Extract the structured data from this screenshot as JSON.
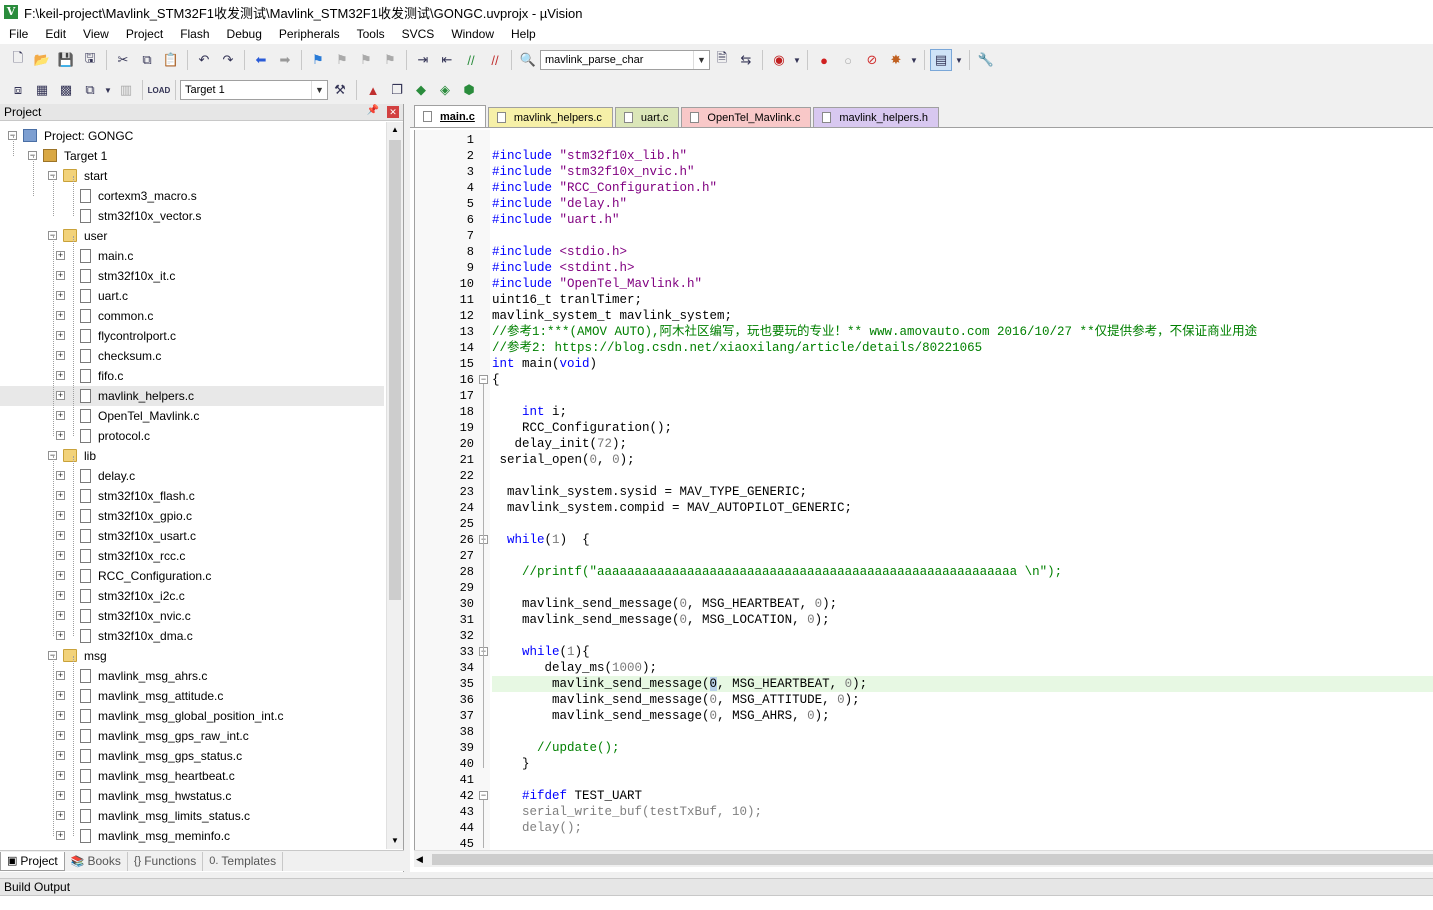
{
  "window": {
    "title": "F:\\keil-project\\Mavlink_STM32F1收发测试\\Mavlink_STM32F1收发测试\\GONGC.uvprojx - µVision"
  },
  "menu": [
    "File",
    "Edit",
    "View",
    "Project",
    "Flash",
    "Debug",
    "Peripherals",
    "Tools",
    "SVCS",
    "Window",
    "Help"
  ],
  "toolbar": {
    "find_combo": "mavlink_parse_char",
    "target_combo": "Target 1"
  },
  "project_panel": {
    "title": "Project",
    "tree": [
      {
        "label": "Project: GONGC",
        "level": 0,
        "type": "proj",
        "exp": "-"
      },
      {
        "label": "Target 1",
        "level": 1,
        "type": "tgt",
        "exp": "-"
      },
      {
        "label": "start",
        "level": 2,
        "type": "folder",
        "exp": "-"
      },
      {
        "label": "cortexm3_macro.s",
        "level": 3,
        "type": "file",
        "exp": ""
      },
      {
        "label": "stm32f10x_vector.s",
        "level": 3,
        "type": "file",
        "exp": ""
      },
      {
        "label": "user",
        "level": 2,
        "type": "folder",
        "exp": "-"
      },
      {
        "label": "main.c",
        "level": 3,
        "type": "file",
        "exp": "+"
      },
      {
        "label": "stm32f10x_it.c",
        "level": 3,
        "type": "file",
        "exp": "+"
      },
      {
        "label": "uart.c",
        "level": 3,
        "type": "file",
        "exp": "+"
      },
      {
        "label": "common.c",
        "level": 3,
        "type": "file",
        "exp": "+"
      },
      {
        "label": "flycontrolport.c",
        "level": 3,
        "type": "file",
        "exp": "+"
      },
      {
        "label": "checksum.c",
        "level": 3,
        "type": "file",
        "exp": "+"
      },
      {
        "label": "fifo.c",
        "level": 3,
        "type": "file",
        "exp": "+"
      },
      {
        "label": "mavlink_helpers.c",
        "level": 3,
        "type": "file",
        "exp": "+",
        "selected": true
      },
      {
        "label": "OpenTel_Mavlink.c",
        "level": 3,
        "type": "file",
        "exp": "+"
      },
      {
        "label": "protocol.c",
        "level": 3,
        "type": "file",
        "exp": "+"
      },
      {
        "label": "lib",
        "level": 2,
        "type": "folder",
        "exp": "-"
      },
      {
        "label": "delay.c",
        "level": 3,
        "type": "file",
        "exp": "+"
      },
      {
        "label": "stm32f10x_flash.c",
        "level": 3,
        "type": "file",
        "exp": "+"
      },
      {
        "label": "stm32f10x_gpio.c",
        "level": 3,
        "type": "file",
        "exp": "+"
      },
      {
        "label": "stm32f10x_usart.c",
        "level": 3,
        "type": "file",
        "exp": "+"
      },
      {
        "label": "stm32f10x_rcc.c",
        "level": 3,
        "type": "file",
        "exp": "+"
      },
      {
        "label": "RCC_Configuration.c",
        "level": 3,
        "type": "file",
        "exp": "+"
      },
      {
        "label": "stm32f10x_i2c.c",
        "level": 3,
        "type": "file",
        "exp": "+"
      },
      {
        "label": "stm32f10x_nvic.c",
        "level": 3,
        "type": "file",
        "exp": "+"
      },
      {
        "label": "stm32f10x_dma.c",
        "level": 3,
        "type": "file",
        "exp": "+"
      },
      {
        "label": "msg",
        "level": 2,
        "type": "folder",
        "exp": "-"
      },
      {
        "label": "mavlink_msg_ahrs.c",
        "level": 3,
        "type": "file",
        "exp": "+"
      },
      {
        "label": "mavlink_msg_attitude.c",
        "level": 3,
        "type": "file",
        "exp": "+"
      },
      {
        "label": "mavlink_msg_global_position_int.c",
        "level": 3,
        "type": "file",
        "exp": "+"
      },
      {
        "label": "mavlink_msg_gps_raw_int.c",
        "level": 3,
        "type": "file",
        "exp": "+"
      },
      {
        "label": "mavlink_msg_gps_status.c",
        "level": 3,
        "type": "file",
        "exp": "+"
      },
      {
        "label": "mavlink_msg_heartbeat.c",
        "level": 3,
        "type": "file",
        "exp": "+"
      },
      {
        "label": "mavlink_msg_hwstatus.c",
        "level": 3,
        "type": "file",
        "exp": "+"
      },
      {
        "label": "mavlink_msg_limits_status.c",
        "level": 3,
        "type": "file",
        "exp": "+"
      },
      {
        "label": "mavlink_msg_meminfo.c",
        "level": 3,
        "type": "file",
        "exp": "+"
      }
    ],
    "tabs": [
      "Project",
      "Books",
      "Functions",
      "Templates"
    ]
  },
  "editor": {
    "tabs": [
      {
        "label": "main.c",
        "color": "#ffffff",
        "active": true
      },
      {
        "label": "mavlink_helpers.c",
        "color": "#f6f0a8"
      },
      {
        "label": "uart.c",
        "color": "#dbe6b8"
      },
      {
        "label": "OpenTel_Mavlink.c",
        "color": "#f8c8c8"
      },
      {
        "label": "mavlink_helpers.h",
        "color": "#d8c8f0"
      }
    ],
    "current_line": 35,
    "lines": [
      {
        "n": 1,
        "t": []
      },
      {
        "n": 2,
        "t": [
          [
            "pp",
            "#include "
          ],
          [
            "str",
            "\"stm32f10x_lib.h\""
          ]
        ]
      },
      {
        "n": 3,
        "t": [
          [
            "pp",
            "#include "
          ],
          [
            "str",
            "\"stm32f10x_nvic.h\""
          ]
        ]
      },
      {
        "n": 4,
        "t": [
          [
            "pp",
            "#include "
          ],
          [
            "str",
            "\"RCC_Configuration.h\""
          ]
        ]
      },
      {
        "n": 5,
        "t": [
          [
            "pp",
            "#include "
          ],
          [
            "str",
            "\"delay.h\""
          ]
        ]
      },
      {
        "n": 6,
        "t": [
          [
            "pp",
            "#include "
          ],
          [
            "str",
            "\"uart.h\""
          ]
        ]
      },
      {
        "n": 7,
        "t": []
      },
      {
        "n": 8,
        "t": [
          [
            "pp",
            "#include "
          ],
          [
            "str",
            "<stdio.h>"
          ]
        ]
      },
      {
        "n": 9,
        "t": [
          [
            "pp",
            "#include "
          ],
          [
            "str",
            "<stdint.h>"
          ]
        ]
      },
      {
        "n": 10,
        "t": [
          [
            "pp",
            "#include "
          ],
          [
            "str",
            "\"OpenTel_Mavlink.h\""
          ]
        ]
      },
      {
        "n": 11,
        "t": [
          [
            "",
            "uint16_t tranlTimer;"
          ]
        ]
      },
      {
        "n": 12,
        "t": [
          [
            "",
            "mavlink_system_t mavlink_system;"
          ]
        ]
      },
      {
        "n": 13,
        "t": [
          [
            "cm",
            "//参考1:***(AMOV AUTO),阿木社区编写，玩也要玩的专业！** www.amovauto.com 2016/10/27 **仅提供参考，不保证商业用途"
          ]
        ]
      },
      {
        "n": 14,
        "t": [
          [
            "cm",
            "//参考2: https://blog.csdn.net/xiaoxilang/article/details/80221065"
          ]
        ]
      },
      {
        "n": 15,
        "t": [
          [
            "kw",
            "int"
          ],
          [
            "",
            " main("
          ],
          [
            "kw",
            "void"
          ],
          [
            "",
            ")"
          ]
        ]
      },
      {
        "n": 16,
        "t": [
          [
            "",
            "{"
          ]
        ],
        "fold": "-"
      },
      {
        "n": 17,
        "t": []
      },
      {
        "n": 18,
        "t": [
          [
            "",
            "    "
          ],
          [
            "kw",
            "int"
          ],
          [
            "",
            " i;"
          ]
        ]
      },
      {
        "n": 19,
        "t": [
          [
            "",
            "    RCC_Configuration();"
          ]
        ]
      },
      {
        "n": 20,
        "t": [
          [
            "",
            "   delay_init("
          ],
          [
            "num",
            "72"
          ],
          [
            "",
            ");"
          ]
        ]
      },
      {
        "n": 21,
        "t": [
          [
            "",
            " serial_open("
          ],
          [
            "num",
            "0"
          ],
          [
            "",
            ", "
          ],
          [
            "num",
            "0"
          ],
          [
            "",
            ");"
          ]
        ]
      },
      {
        "n": 22,
        "t": []
      },
      {
        "n": 23,
        "t": [
          [
            "",
            "  mavlink_system.sysid = MAV_TYPE_GENERIC;"
          ]
        ]
      },
      {
        "n": 24,
        "t": [
          [
            "",
            "  mavlink_system.compid = MAV_AUTOPILOT_GENERIC;"
          ]
        ]
      },
      {
        "n": 25,
        "t": []
      },
      {
        "n": 26,
        "t": [
          [
            "",
            "  "
          ],
          [
            "kw",
            "while"
          ],
          [
            "",
            "("
          ],
          [
            "num",
            "1"
          ],
          [
            "",
            ")  {"
          ]
        ],
        "fold": "-"
      },
      {
        "n": 27,
        "t": []
      },
      {
        "n": 28,
        "t": [
          [
            "",
            "    "
          ],
          [
            "cm",
            "//printf(\"aaaaaaaaaaaaaaaaaaaaaaaaaaaaaaaaaaaaaaaaaaaaaaaaaaaaaaaa \\n\");"
          ]
        ]
      },
      {
        "n": 29,
        "t": []
      },
      {
        "n": 30,
        "t": [
          [
            "",
            "    mavlink_send_message("
          ],
          [
            "num",
            "0"
          ],
          [
            "",
            ", MSG_HEARTBEAT, "
          ],
          [
            "num",
            "0"
          ],
          [
            "",
            ");"
          ]
        ]
      },
      {
        "n": 31,
        "t": [
          [
            "",
            "    mavlink_send_message("
          ],
          [
            "num",
            "0"
          ],
          [
            "",
            ", MSG_LOCATION, "
          ],
          [
            "num",
            "0"
          ],
          [
            "",
            ");"
          ]
        ]
      },
      {
        "n": 32,
        "t": []
      },
      {
        "n": 33,
        "t": [
          [
            "",
            "    "
          ],
          [
            "kw",
            "while"
          ],
          [
            "",
            "("
          ],
          [
            "num",
            "1"
          ],
          [
            "",
            "){"
          ]
        ],
        "fold": "-"
      },
      {
        "n": 34,
        "t": [
          [
            "",
            "       delay_ms("
          ],
          [
            "num",
            "1000"
          ],
          [
            "",
            ");"
          ]
        ]
      },
      {
        "n": 35,
        "t": [
          [
            "",
            "        mavlink_send_message("
          ],
          [
            "cursor",
            "0"
          ],
          [
            "",
            ", MSG_HEARTBEAT, "
          ],
          [
            "num",
            "0"
          ],
          [
            "",
            ");"
          ]
        ]
      },
      {
        "n": 36,
        "t": [
          [
            "",
            "        mavlink_send_message("
          ],
          [
            "num",
            "0"
          ],
          [
            "",
            ", MSG_ATTITUDE, "
          ],
          [
            "num",
            "0"
          ],
          [
            "",
            ");"
          ]
        ]
      },
      {
        "n": 37,
        "t": [
          [
            "",
            "        mavlink_send_message("
          ],
          [
            "num",
            "0"
          ],
          [
            "",
            ", MSG_AHRS, "
          ],
          [
            "num",
            "0"
          ],
          [
            "",
            ");"
          ]
        ]
      },
      {
        "n": 38,
        "t": []
      },
      {
        "n": 39,
        "t": [
          [
            "",
            "      "
          ],
          [
            "cm",
            "//update();"
          ]
        ]
      },
      {
        "n": 40,
        "t": [
          [
            "",
            "    }"
          ]
        ]
      },
      {
        "n": 41,
        "t": []
      },
      {
        "n": 42,
        "t": [
          [
            "",
            "    "
          ],
          [
            "kw",
            "#ifdef"
          ],
          [
            "",
            " TEST_UART"
          ]
        ],
        "fold": "-"
      },
      {
        "n": 43,
        "t": [
          [
            "",
            "    "
          ],
          [
            "gray",
            "serial_write_buf(testTxBuf, 10);"
          ]
        ]
      },
      {
        "n": 44,
        "t": [
          [
            "",
            "    "
          ],
          [
            "gray",
            "delay();"
          ]
        ]
      },
      {
        "n": 45,
        "t": []
      }
    ]
  },
  "build_output": {
    "title": "Build Output"
  }
}
